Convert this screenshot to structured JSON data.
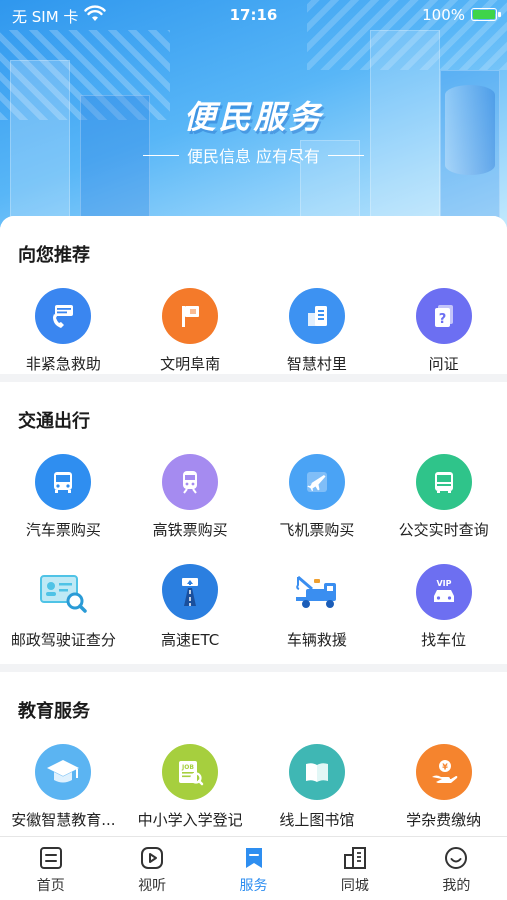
{
  "status_bar": {
    "carrier": "无 SIM 卡",
    "time": "17:16",
    "battery": "100%"
  },
  "hero": {
    "title": "便民服务",
    "subtitle": "便民信息 应有尽有"
  },
  "sections": [
    {
      "title": "向您推荐",
      "items": [
        {
          "label": "非紧急救助",
          "icon": "phone-help-icon",
          "color": "#3a86f0"
        },
        {
          "label": "文明阜南",
          "icon": "flag-icon",
          "color": "#f47a2a"
        },
        {
          "label": "智慧村里",
          "icon": "building-doc-icon",
          "color": "#3d92f2"
        },
        {
          "label": "问证",
          "icon": "question-doc-icon",
          "color": "#6c6ff2"
        }
      ]
    },
    {
      "title": "交通出行",
      "items": [
        {
          "label": "汽车票购买",
          "icon": "bus-icon",
          "color": "#2f8ef0"
        },
        {
          "label": "高铁票购买",
          "icon": "train-icon",
          "color": "#a58bf0"
        },
        {
          "label": "飞机票购买",
          "icon": "plane-icon",
          "color": "#4aa3f5"
        },
        {
          "label": "公交实时查询",
          "icon": "city-bus-icon",
          "color": "#2fc48a"
        },
        {
          "label": "邮政驾驶证查分",
          "icon": "license-search-icon",
          "color": "#4fc3e6"
        },
        {
          "label": "高速ETC",
          "icon": "highway-icon",
          "color": "#2b7fe0"
        },
        {
          "label": "车辆救援",
          "icon": "tow-truck-icon",
          "color": "#3a8ef0"
        },
        {
          "label": "找车位",
          "icon": "vip-car-icon",
          "color": "#6d6ff1"
        }
      ]
    },
    {
      "title": "教育服务",
      "items": [
        {
          "label": "安徽智慧教育...",
          "icon": "graduation-cap-icon",
          "color": "#5bb4f2"
        },
        {
          "label": "中小学入学登记",
          "icon": "job-search-icon",
          "color": "#a6cf3e"
        },
        {
          "label": "线上图书馆",
          "icon": "book-icon",
          "color": "#3fb7b4"
        },
        {
          "label": "学杂费缴纳",
          "icon": "coin-hand-icon",
          "color": "#f5842e"
        }
      ]
    }
  ],
  "tabbar": [
    {
      "label": "首页",
      "icon": "home-doc-icon",
      "active": false
    },
    {
      "label": "视听",
      "icon": "play-icon",
      "active": false
    },
    {
      "label": "服务",
      "icon": "bookmark-icon",
      "active": true
    },
    {
      "label": "同城",
      "icon": "city-icon",
      "active": false
    },
    {
      "label": "我的",
      "icon": "smile-icon",
      "active": false
    }
  ],
  "colors": {
    "accent": "#2e8ef0",
    "page_bg": "#f2f3f5"
  }
}
